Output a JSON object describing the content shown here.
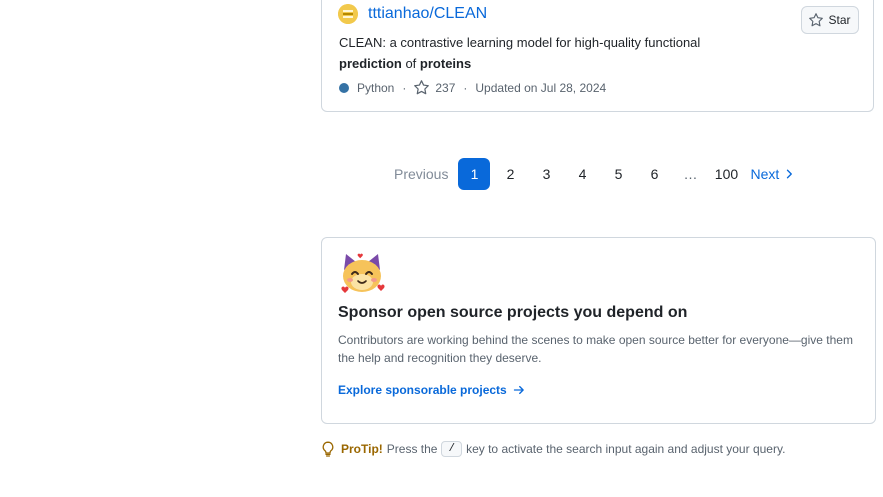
{
  "repo": {
    "owner_repo": "tttianhao/CLEAN",
    "desc_prefix": "CLEAN: a contrastive learning model for high-quality functional",
    "desc_bold1": "prediction",
    "desc_mid": " of ",
    "desc_bold2": "proteins",
    "language": "Python",
    "language_color": "#3572A5",
    "stars": "237",
    "updated": "Updated on Jul 28, 2024",
    "star_button_label": "Star"
  },
  "pagination": {
    "previous": "Previous",
    "pages": [
      "1",
      "2",
      "3",
      "4",
      "5",
      "6"
    ],
    "current": "1",
    "gap": "…",
    "last": "100",
    "next": "Next"
  },
  "sponsor": {
    "title": "Sponsor open source projects you depend on",
    "text": "Contributors are working behind the scenes to make open source better for everyone—give them the help and recognition they deserve.",
    "link": "Explore sponsorable projects"
  },
  "protip": {
    "label": "ProTip!",
    "before": "Press the",
    "key": "/",
    "after": "key to activate the search input again and adjust your query."
  },
  "colors": {
    "accent": "#0969da",
    "border": "#d0d7de",
    "muted": "#59636e"
  }
}
